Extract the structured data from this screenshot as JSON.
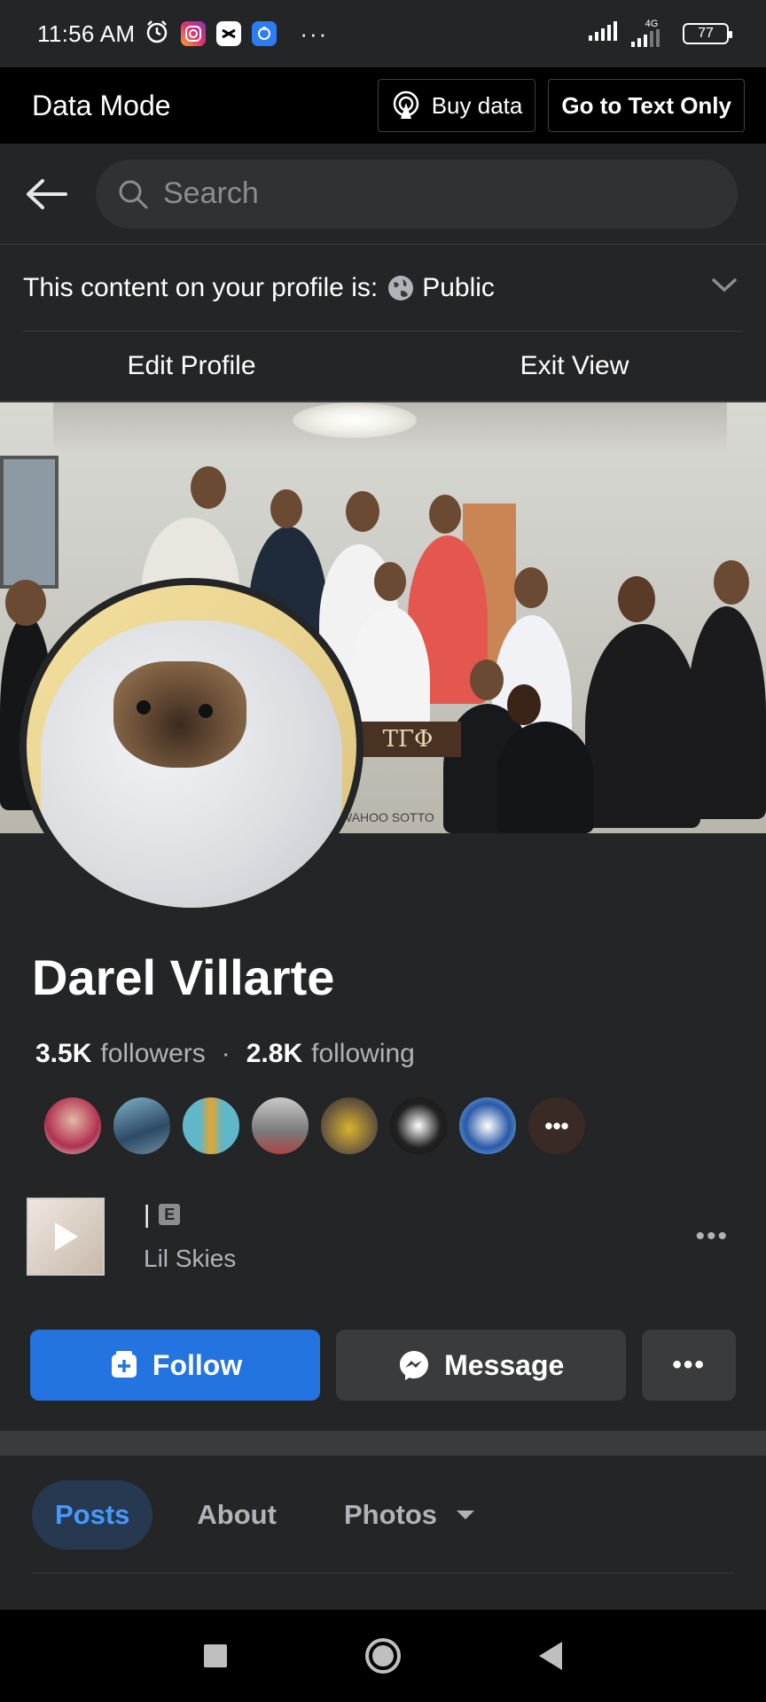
{
  "status_bar": {
    "time": "11:56 AM",
    "network": "4G",
    "battery": "77",
    "more": "···"
  },
  "data_mode": {
    "title": "Data Mode",
    "buy_data": "Buy data",
    "text_only": "Go to Text Only"
  },
  "search": {
    "placeholder": "Search"
  },
  "visibility": {
    "label": "This content on your profile is:",
    "value": "Public"
  },
  "profile_actions": {
    "edit": "Edit Profile",
    "exit": "Exit View"
  },
  "cover": {
    "sign_text": "TΓΦ",
    "caption": "WAHOO SOTTO"
  },
  "profile": {
    "name": "Darel Villarte",
    "followers_count": "3.5K",
    "followers_label": "followers",
    "following_count": "2.8K",
    "following_label": "following",
    "friends_more": "•••"
  },
  "music": {
    "title": "|",
    "explicit": "E",
    "artist": "Lil Skies",
    "more": "•••"
  },
  "buttons": {
    "follow": "Follow",
    "message": "Message",
    "more": "•••"
  },
  "tabs": [
    {
      "label": "Posts",
      "active": true
    },
    {
      "label": "About",
      "active": false
    },
    {
      "label": "Photos",
      "active": false
    }
  ],
  "colors": {
    "background": "#242526",
    "accent": "#2374e1",
    "tab_active": "#4599ff"
  }
}
